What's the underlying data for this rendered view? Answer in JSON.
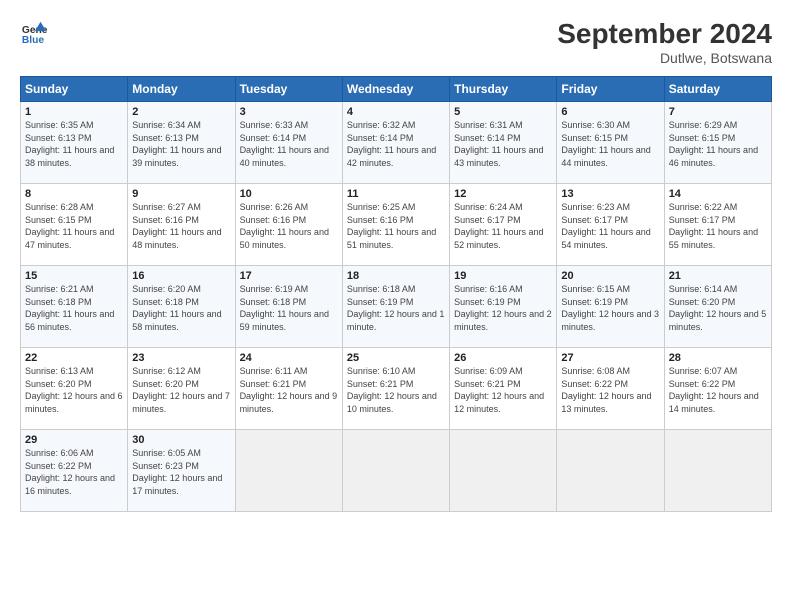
{
  "header": {
    "logo_line1": "General",
    "logo_line2": "Blue",
    "title": "September 2024",
    "subtitle": "Dutlwe, Botswana"
  },
  "weekdays": [
    "Sunday",
    "Monday",
    "Tuesday",
    "Wednesday",
    "Thursday",
    "Friday",
    "Saturday"
  ],
  "weeks": [
    [
      {
        "day": "1",
        "rise": "6:35 AM",
        "set": "6:13 PM",
        "daylight": "11 hours and 38 minutes."
      },
      {
        "day": "2",
        "rise": "6:34 AM",
        "set": "6:13 PM",
        "daylight": "11 hours and 39 minutes."
      },
      {
        "day": "3",
        "rise": "6:33 AM",
        "set": "6:14 PM",
        "daylight": "11 hours and 40 minutes."
      },
      {
        "day": "4",
        "rise": "6:32 AM",
        "set": "6:14 PM",
        "daylight": "11 hours and 42 minutes."
      },
      {
        "day": "5",
        "rise": "6:31 AM",
        "set": "6:14 PM",
        "daylight": "11 hours and 43 minutes."
      },
      {
        "day": "6",
        "rise": "6:30 AM",
        "set": "6:15 PM",
        "daylight": "11 hours and 44 minutes."
      },
      {
        "day": "7",
        "rise": "6:29 AM",
        "set": "6:15 PM",
        "daylight": "11 hours and 46 minutes."
      }
    ],
    [
      {
        "day": "8",
        "rise": "6:28 AM",
        "set": "6:15 PM",
        "daylight": "11 hours and 47 minutes."
      },
      {
        "day": "9",
        "rise": "6:27 AM",
        "set": "6:16 PM",
        "daylight": "11 hours and 48 minutes."
      },
      {
        "day": "10",
        "rise": "6:26 AM",
        "set": "6:16 PM",
        "daylight": "11 hours and 50 minutes."
      },
      {
        "day": "11",
        "rise": "6:25 AM",
        "set": "6:16 PM",
        "daylight": "11 hours and 51 minutes."
      },
      {
        "day": "12",
        "rise": "6:24 AM",
        "set": "6:17 PM",
        "daylight": "11 hours and 52 minutes."
      },
      {
        "day": "13",
        "rise": "6:23 AM",
        "set": "6:17 PM",
        "daylight": "11 hours and 54 minutes."
      },
      {
        "day": "14",
        "rise": "6:22 AM",
        "set": "6:17 PM",
        "daylight": "11 hours and 55 minutes."
      }
    ],
    [
      {
        "day": "15",
        "rise": "6:21 AM",
        "set": "6:18 PM",
        "daylight": "11 hours and 56 minutes."
      },
      {
        "day": "16",
        "rise": "6:20 AM",
        "set": "6:18 PM",
        "daylight": "11 hours and 58 minutes."
      },
      {
        "day": "17",
        "rise": "6:19 AM",
        "set": "6:18 PM",
        "daylight": "11 hours and 59 minutes."
      },
      {
        "day": "18",
        "rise": "6:18 AM",
        "set": "6:19 PM",
        "daylight": "12 hours and 1 minute."
      },
      {
        "day": "19",
        "rise": "6:16 AM",
        "set": "6:19 PM",
        "daylight": "12 hours and 2 minutes."
      },
      {
        "day": "20",
        "rise": "6:15 AM",
        "set": "6:19 PM",
        "daylight": "12 hours and 3 minutes."
      },
      {
        "day": "21",
        "rise": "6:14 AM",
        "set": "6:20 PM",
        "daylight": "12 hours and 5 minutes."
      }
    ],
    [
      {
        "day": "22",
        "rise": "6:13 AM",
        "set": "6:20 PM",
        "daylight": "12 hours and 6 minutes."
      },
      {
        "day": "23",
        "rise": "6:12 AM",
        "set": "6:20 PM",
        "daylight": "12 hours and 7 minutes."
      },
      {
        "day": "24",
        "rise": "6:11 AM",
        "set": "6:21 PM",
        "daylight": "12 hours and 9 minutes."
      },
      {
        "day": "25",
        "rise": "6:10 AM",
        "set": "6:21 PM",
        "daylight": "12 hours and 10 minutes."
      },
      {
        "day": "26",
        "rise": "6:09 AM",
        "set": "6:21 PM",
        "daylight": "12 hours and 12 minutes."
      },
      {
        "day": "27",
        "rise": "6:08 AM",
        "set": "6:22 PM",
        "daylight": "12 hours and 13 minutes."
      },
      {
        "day": "28",
        "rise": "6:07 AM",
        "set": "6:22 PM",
        "daylight": "12 hours and 14 minutes."
      }
    ],
    [
      {
        "day": "29",
        "rise": "6:06 AM",
        "set": "6:22 PM",
        "daylight": "12 hours and 16 minutes."
      },
      {
        "day": "30",
        "rise": "6:05 AM",
        "set": "6:23 PM",
        "daylight": "12 hours and 17 minutes."
      },
      null,
      null,
      null,
      null,
      null
    ]
  ]
}
